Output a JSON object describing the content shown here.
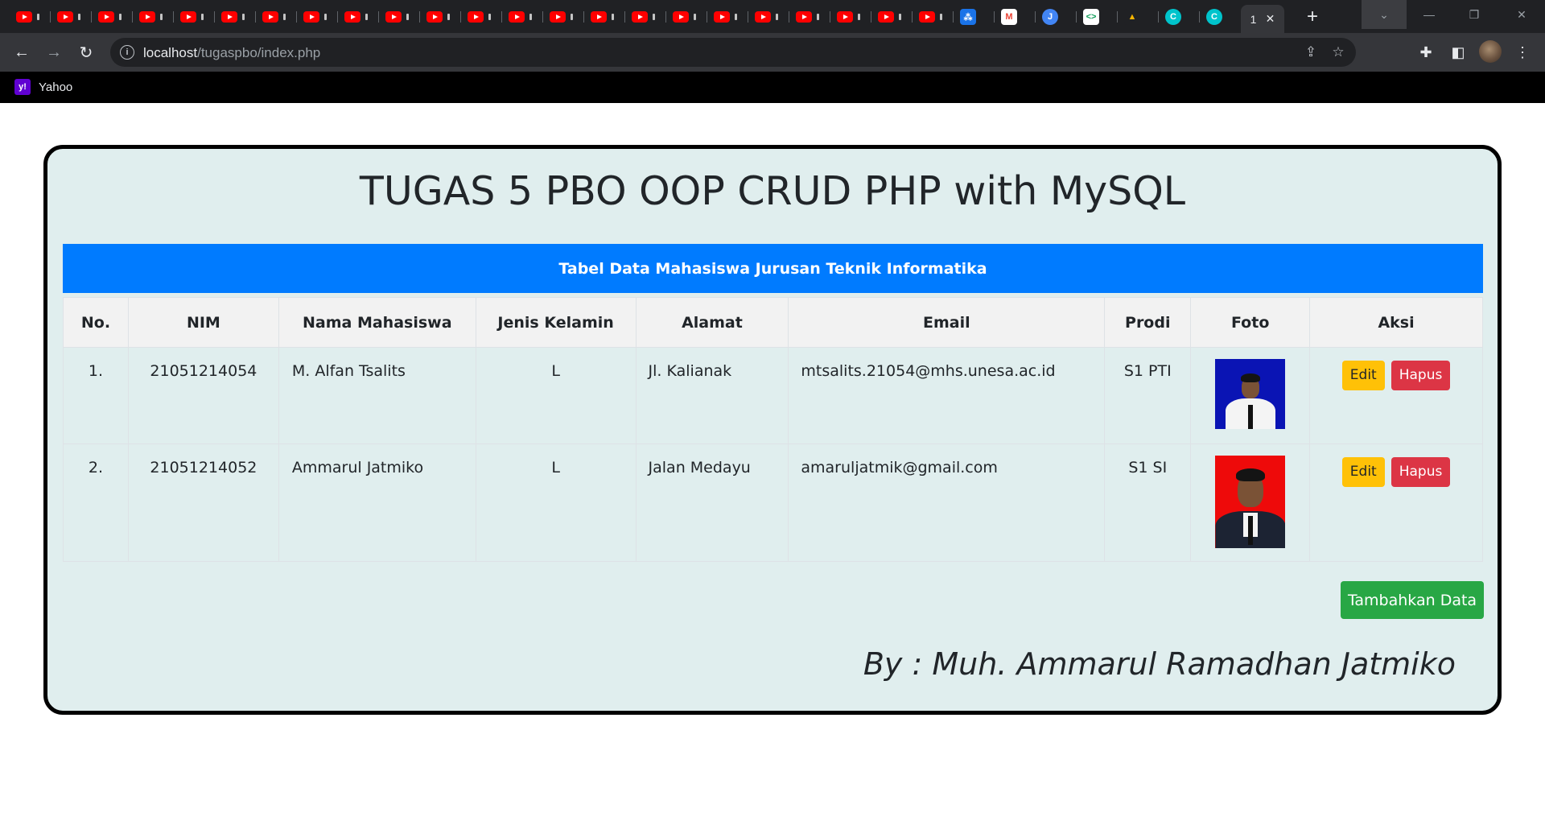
{
  "browser": {
    "active_tab_title": "1",
    "url_host": "localhost",
    "url_path": "/tugaspbo/index.php",
    "bookmark": "Yahoo"
  },
  "page": {
    "title": "TUGAS 5 PBO OOP CRUD PHP with MySQL",
    "table_caption": "Tabel Data Mahasiswa Jurusan Teknik Informatika",
    "columns": [
      "No.",
      "NIM",
      "Nama Mahasiswa",
      "Jenis Kelamin",
      "Alamat",
      "Email",
      "Prodi",
      "Foto",
      "Aksi"
    ],
    "rows": [
      {
        "no": "1.",
        "nim": "21051214054",
        "nama": "M. Alfan Tsalits",
        "jk": "L",
        "alamat": "Jl. Kalianak",
        "email": "mtsalits.21054@mhs.unesa.ac.id",
        "prodi": "S1 PTI",
        "edit": "Edit",
        "hapus": "Hapus"
      },
      {
        "no": "2.",
        "nim": "21051214052",
        "nama": "Ammarul Jatmiko",
        "jk": "L",
        "alamat": "Jalan Medayu",
        "email": "amaruljatmik@gmail.com",
        "prodi": "S1 SI",
        "edit": "Edit",
        "hapus": "Hapus"
      }
    ],
    "add_button": "Tambahkan Data",
    "byline": "By : Muh. Ammarul Ramadhan Jatmiko"
  },
  "colors": {
    "card_bg": "#e0eeee",
    "header_bar": "#007bff",
    "edit": "#ffc107",
    "delete": "#dc3545",
    "add": "#28a745"
  }
}
